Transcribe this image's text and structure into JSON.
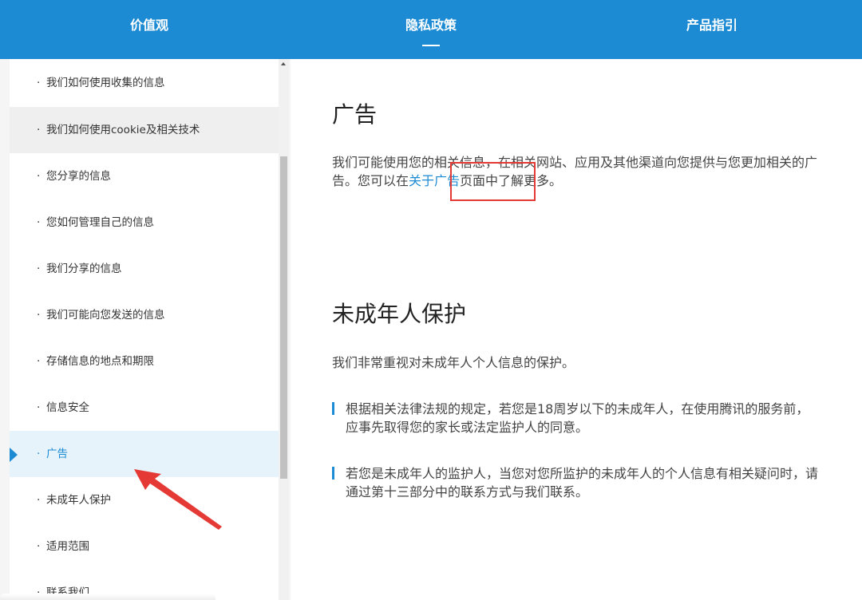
{
  "topnav": {
    "items": [
      {
        "label": "价值观"
      },
      {
        "label": "隐私政策"
      },
      {
        "label": "产品指引"
      }
    ]
  },
  "sidebar": {
    "items": [
      {
        "label": "我们如何使用收集的信息"
      },
      {
        "label": "我们如何使用cookie及相关技术"
      },
      {
        "label": "您分享的信息"
      },
      {
        "label": "您如何管理自己的信息"
      },
      {
        "label": "我们分享的信息"
      },
      {
        "label": "我们可能向您发送的信息"
      },
      {
        "label": "存储信息的地点和期限"
      },
      {
        "label": "信息安全"
      },
      {
        "label": "广告"
      },
      {
        "label": "未成年人保护"
      },
      {
        "label": "适用范围"
      },
      {
        "label": "联系我们"
      }
    ],
    "dot": "·",
    "active_index": 8
  },
  "main": {
    "ads": {
      "title": "广告",
      "text_before": "我们可能使用您的相关信息，在相关网站、应用及其他渠道向您提供与您更加相关的广告。您可以在",
      "link": "关于广告",
      "text_after": "页面中了解更多。"
    },
    "minors": {
      "title": "未成年人保护",
      "intro": "我们非常重视对未成年人个人信息的保护。",
      "bullets": [
        "根据相关法律法规的规定，若您是18周岁以下的未成年人，在使用腾讯的服务前，应事先取得您的家长或法定监护人的同意。",
        "若您是未成年人的监护人，当您对您所监护的未成年人的个人信息有相关疑问时，请通过第十三部分中的联系方式与我们联系。"
      ]
    }
  },
  "colors": {
    "nav_bg": "#1c8bd3",
    "accent": "#1c8bd3",
    "annotation": "#e53935"
  }
}
